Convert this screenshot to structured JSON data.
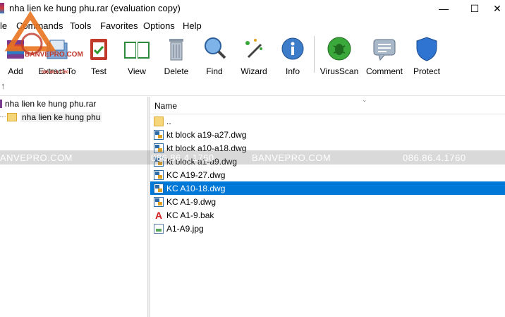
{
  "window": {
    "title": "nha lien ke hung phu.rar (evaluation copy)",
    "minimize_glyph": "—",
    "maximize_glyph": "☐",
    "close_glyph": "✕"
  },
  "menu": [
    "le",
    "Commands",
    "Tools",
    "Favorites",
    "Options",
    "Help"
  ],
  "toolbar": {
    "add": "Add",
    "extract_to": "Extract To",
    "test": "Test",
    "view": "View",
    "delete": "Delete",
    "find": "Find",
    "wizard": "Wizard",
    "info": "Info",
    "virusscan": "VirusScan",
    "comment": "Comment",
    "protect": "Protect"
  },
  "address": {
    "up_glyph": "↑"
  },
  "tree": {
    "root": "nha lien ke hung phu.rar",
    "child": "nha lien ke hung phu"
  },
  "list": {
    "column_name": "Name",
    "sort_glyph": "⌄",
    "rows": [
      {
        "name": "..",
        "icon": "folder-icon"
      },
      {
        "name": "kt block a19-a27.dwg",
        "icon": "dwg-file-icon"
      },
      {
        "name": "kt block a10-a18.dwg",
        "icon": "dwg-file-icon"
      },
      {
        "name": "kt block a1-a9.dwg",
        "icon": "dwg-file-icon"
      },
      {
        "name": "KC A19-27.dwg",
        "icon": "dwg-file-icon"
      },
      {
        "name": "KC A10-18.dwg",
        "icon": "dwg-file-icon",
        "selected": true
      },
      {
        "name": "KC A1-9.dwg",
        "icon": "dwg-file-icon"
      },
      {
        "name": "KC A1-9.bak",
        "icon": "autocad-bak-icon"
      },
      {
        "name": "A1-A9.jpg",
        "icon": "image-file-icon"
      }
    ]
  },
  "watermark": {
    "left": "ANVEPRO.COM",
    "middle1": "086.86.4.1760",
    "middle2": "BANVEPRO.COM",
    "right": "086.86.4.1760"
  },
  "logo": {
    "text": "BANVEPRO.COM",
    "phone": "086.86.4.1760"
  },
  "colors": {
    "selection": "#0078d7",
    "watermark": "#c0392b"
  }
}
